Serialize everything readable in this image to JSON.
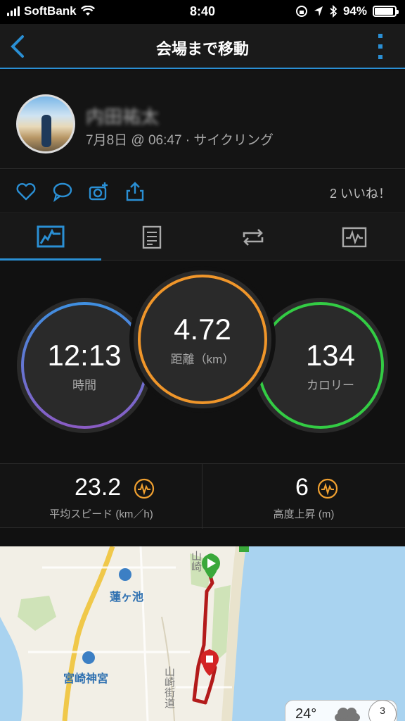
{
  "status": {
    "carrier": "SoftBank",
    "time": "8:40",
    "battery": "94%",
    "battery_level": 0.94
  },
  "nav": {
    "title": "会場まで移動"
  },
  "profile": {
    "name": "内田祐太",
    "meta": "7月8日 @ 06:47 · サイクリング"
  },
  "actions": {
    "likes": "2 いいね！"
  },
  "tabs": [
    "summary",
    "details",
    "laps",
    "charts"
  ],
  "stats": {
    "time": {
      "value": "12:13",
      "label": "時間"
    },
    "distance": {
      "value": "4.72",
      "label": "距離（km）"
    },
    "calories": {
      "value": "134",
      "label": "カロリー"
    }
  },
  "metrics": {
    "avg_speed": {
      "value": "23.2",
      "label": "平均スピード (km／h)"
    },
    "elevation": {
      "value": "6",
      "label": "高度上昇 (m)"
    }
  },
  "map": {
    "labels": {
      "station": "蓮ヶ池",
      "shrine": "宮崎神宮",
      "road1": "山崎街道",
      "road2": "山崎"
    },
    "weather_temp": "24°",
    "compass": "3"
  }
}
